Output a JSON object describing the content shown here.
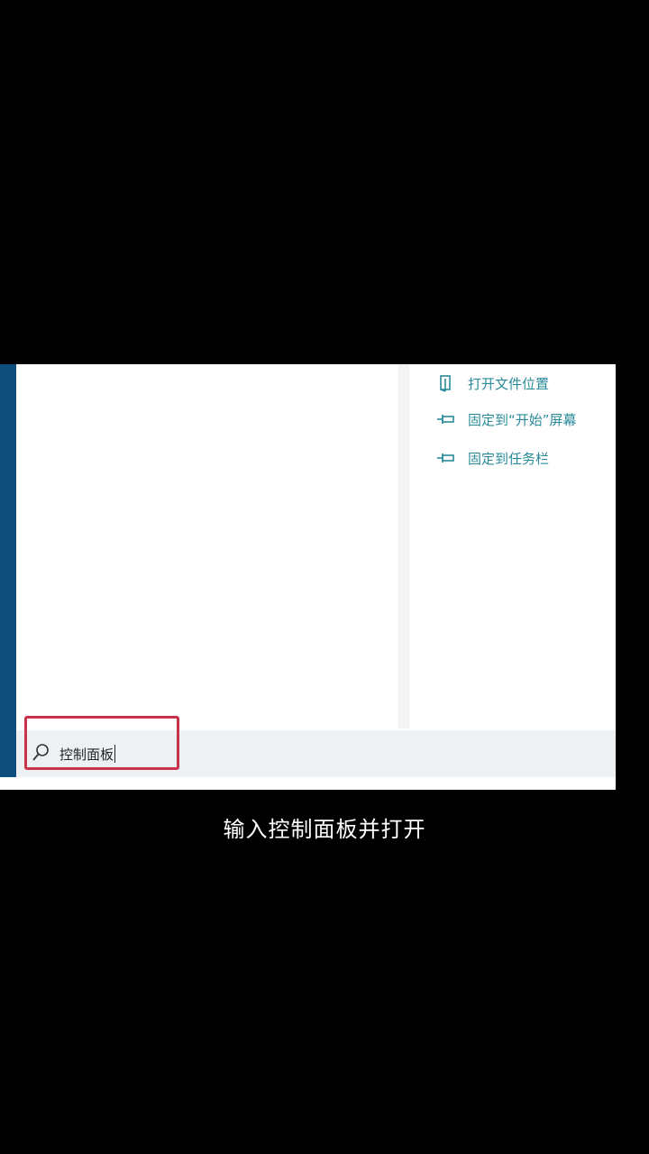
{
  "actions": [
    {
      "icon": "open-folder-icon",
      "label": "打开文件位置"
    },
    {
      "icon": "pin-icon",
      "label": "固定到“开始”屏幕"
    },
    {
      "icon": "pin-icon",
      "label": "固定到任务栏"
    }
  ],
  "search": {
    "value": "控制面板"
  },
  "caption": "输入控制面板并打开",
  "colors": {
    "accent_bar": "#0e4e7c",
    "action_text": "#2a8a9a",
    "highlight_box": "#c9324a"
  }
}
